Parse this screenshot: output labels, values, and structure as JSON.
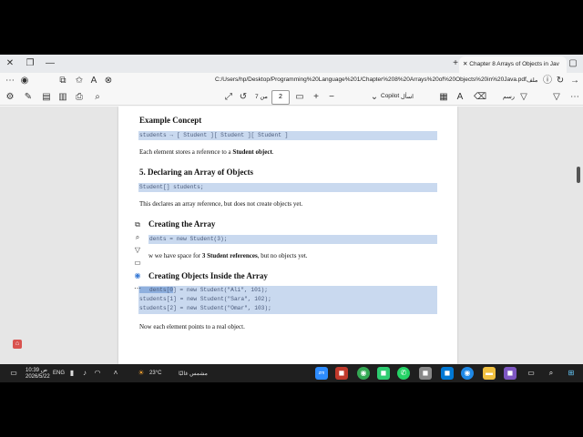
{
  "browser": {
    "tab_title": "Chapter 8 Arrays of Objects in Jav",
    "address": "C:/Users/hp/Desktop/Programming%20Language%201/Chapter%208%20Arrays%20of%20Objects%20in%20Java.pdf",
    "file_label": "ملف",
    "page_current": "2",
    "page_of": "من 7",
    "copilot_label": "Copilot",
    "ask_label": "اسأل",
    "draw_label": "رسم",
    "left_label": "الترجمة"
  },
  "document": {
    "h_example": "Example Concept",
    "code_example": "students → [ Student ][ Student ][ Student ]",
    "p_each": "Each element stores a reference to a ",
    "p_each_bold": "Student object",
    "p_each_end": ".",
    "h5": "5. Declaring an Array of Objects",
    "code_decl": "Student[] students;",
    "p_decl": "This declares an array reference, but does not create objects yet.",
    "h_create": "Creating the Array",
    "code_create": "dents = new Student(3);",
    "p_space_a": "w we have space for ",
    "p_space_b": "3 Student references",
    "p_space_c": ", but no objects yet.",
    "h_inside": "Creating Objects Inside the Array",
    "code1_sel": "dents[0",
    "code1": "] = new Student(\"Ali\", 101);",
    "code2a": "students[1",
    "code2b": "] = new Student(\"Sara\", 102);",
    "code3": "students[2] = new Student(\"Omar\", 103);",
    "p_now": "Now each element points to a real object."
  },
  "taskbar": {
    "weather_temp": "23°C",
    "weather_text": "مشمس غالبًا",
    "lang": "ENG",
    "time": "10:39 ص",
    "date": "2026/5/22"
  }
}
